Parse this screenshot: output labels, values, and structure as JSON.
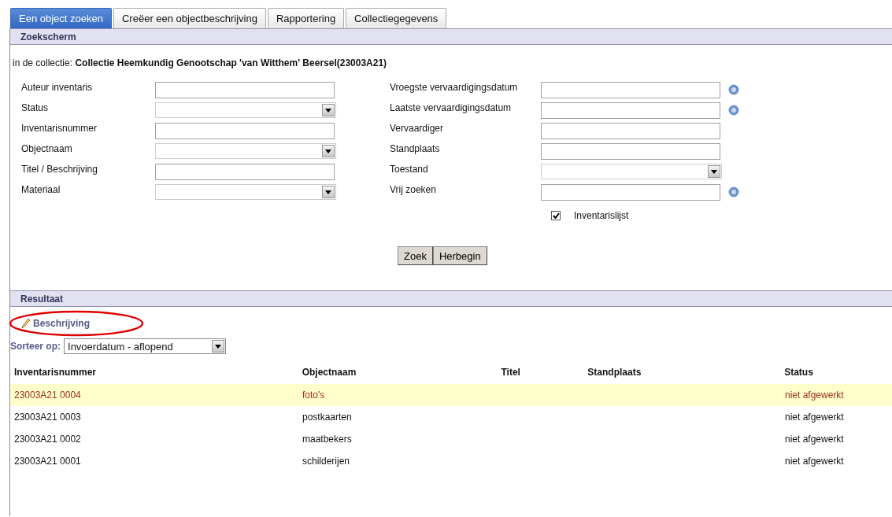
{
  "tabs": [
    {
      "label": "Een object zoeken",
      "selected": true
    },
    {
      "label": "Creëer een objectbeschrijving",
      "selected": false
    },
    {
      "label": "Rapportering",
      "selected": false
    },
    {
      "label": "Collectiegegevens",
      "selected": false
    }
  ],
  "search_section": {
    "title": "Zoekscherm",
    "collection_label": "in de collectie:",
    "collection_name": "Collectie Heemkundig Genootschap 'van Witthem' Beersel(23003A21)",
    "left_fields": [
      {
        "label": "Auteur inventaris",
        "kind": "text",
        "help": false
      },
      {
        "label": "Status",
        "kind": "select",
        "help": false
      },
      {
        "label": "Inventarisnummer",
        "kind": "text",
        "help": false
      },
      {
        "label": "Objectnaam",
        "kind": "select",
        "help": false
      },
      {
        "label": "Titel / Beschrijving",
        "kind": "text",
        "help": false
      },
      {
        "label": "Materiaal",
        "kind": "select",
        "help": false
      }
    ],
    "right_fields": [
      {
        "label": "Vroegste vervaardigingsdatum",
        "kind": "text",
        "help": true
      },
      {
        "label": "Laatste vervaardigingsdatum",
        "kind": "text",
        "help": true
      },
      {
        "label": "Vervaardiger",
        "kind": "text",
        "help": false
      },
      {
        "label": "Standplaats",
        "kind": "text",
        "help": false
      },
      {
        "label": "Toestand",
        "kind": "select",
        "help": false
      },
      {
        "label": "Vrij zoeken",
        "kind": "text",
        "help": true
      }
    ],
    "checkbox": {
      "label": "Inventarislijst",
      "checked": true
    },
    "buttons": [
      "Zoek",
      "Herbegin"
    ]
  },
  "results_section": {
    "title": "Resultaat",
    "describe_link": "Beschrijving",
    "sort_label": "Sorteer op:",
    "sort_value": "Invoerdatum - aflopend",
    "columns": [
      "Inventarisnummer",
      "Objectnaam",
      "Titel",
      "Standplaats",
      "Status"
    ],
    "rows": [
      {
        "cells": [
          "23003A21  0004",
          "foto's",
          "",
          "",
          "niet afgewerkt"
        ],
        "selected": true
      },
      {
        "cells": [
          "23003A21  0003",
          "postkaarten",
          "",
          "",
          "niet afgewerkt"
        ],
        "selected": false
      },
      {
        "cells": [
          "23003A21  0002",
          "maatbekers",
          "",
          "",
          "niet afgewerkt"
        ],
        "selected": false
      },
      {
        "cells": [
          "23003A21  0001",
          "schilderijen",
          "",
          "",
          "niet afgewerkt"
        ],
        "selected": false
      }
    ]
  }
}
